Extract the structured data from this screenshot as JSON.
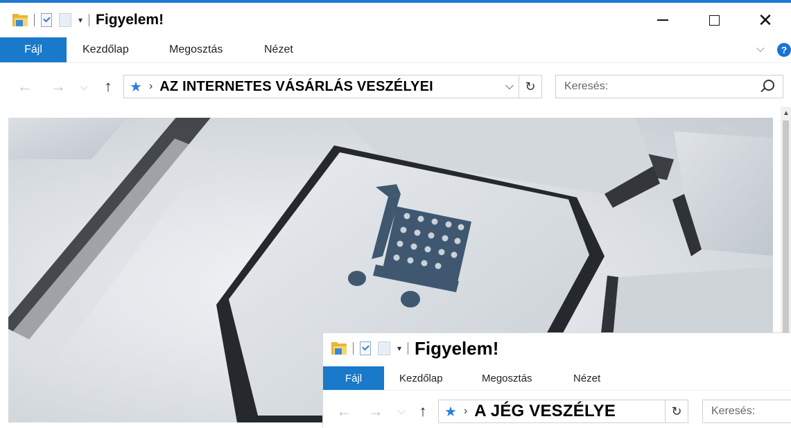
{
  "window1": {
    "title": "Figyelem!",
    "tabs": {
      "file": "Fájl",
      "home": "Kezdőlap",
      "share": "Megosztás",
      "view": "Nézet"
    },
    "address_path": "AZ INTERNETES VÁSÁRLÁS VESZÉLYEI",
    "search_placeholder": "Keresés:"
  },
  "window2": {
    "title": "Figyelem!",
    "tabs": {
      "file": "Fájl",
      "home": "Kezdőlap",
      "share": "Megosztás",
      "view": "Nézet"
    },
    "address_path": "A JÉG VESZÉLYE",
    "search_placeholder": "Keresés:"
  },
  "icons": {
    "window_controls": [
      "minimize-icon",
      "maximize-icon",
      "close-icon"
    ],
    "address_pin": "quick-access-star-icon",
    "content_image": "shopping-cart-keyboard-key"
  },
  "colors": {
    "accent": "#1979ca",
    "star": "#2a7fde",
    "cart": "#3f5870"
  }
}
